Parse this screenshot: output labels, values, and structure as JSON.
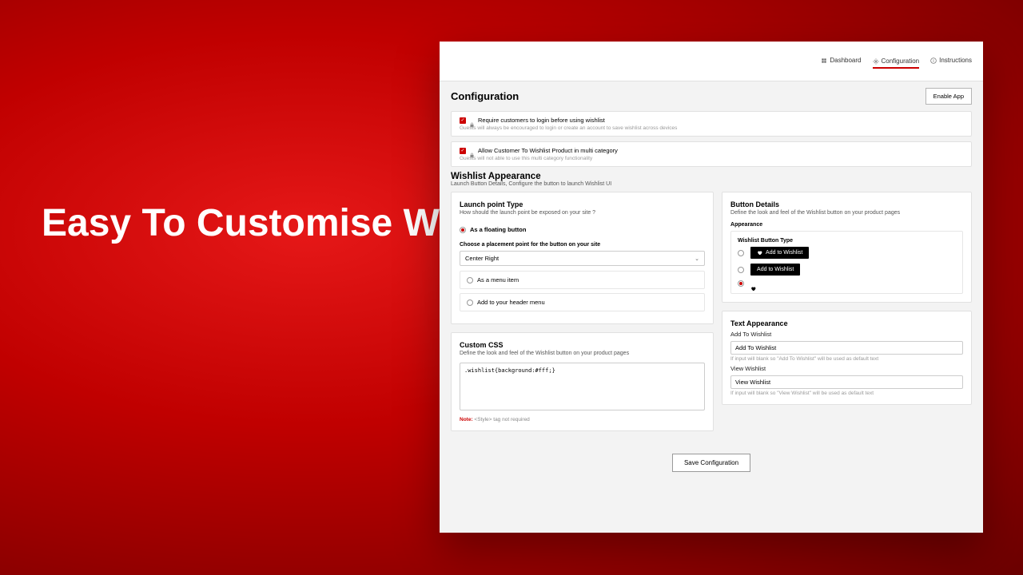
{
  "hero": "Easy To Customise With Custom CSS",
  "nav": {
    "dashboard": "Dashboard",
    "configuration": "Configuration",
    "instructions": "Instructions"
  },
  "page": {
    "title": "Configuration",
    "enable": "Enable App"
  },
  "opt1": {
    "label": "Require customers to login before using wishlist",
    "help": "Guests will always be encouraged to login or create an account to save wishlist across devices"
  },
  "opt2": {
    "label": "Allow Customer To Wishlist Product in multi category",
    "help": "Guests will not able to use this multi category functionality"
  },
  "appearance": {
    "title": "Wishlist Appearance",
    "sub": "Launch Button Details, Configure the button to launch Wishlist UI"
  },
  "launch": {
    "title": "Launch point Type",
    "sub": "How should the launch point be exposed on your site ?",
    "r1": "As a floating button",
    "placementLabel": "Choose a placement point for the button on your site",
    "placementValue": "Center Right",
    "r2": "As a menu item",
    "r3": "Add to your header menu"
  },
  "buttonDetails": {
    "title": "Button Details",
    "sub": "Define the look and feel of the Wishlist button on your product pages",
    "appLabel": "Appearance",
    "typeLabel": "Wishlist Button Type",
    "b1": "Add to Wishlist",
    "b2": "Add to Wishlist"
  },
  "customCss": {
    "title": "Custom CSS",
    "sub": "Define the look and feel of the Wishlist button on your product pages",
    "value": ".wishlist{background:#fff;}",
    "noteRed": "Note:",
    "noteGray": " <Style> tag not required"
  },
  "textApp": {
    "title": "Text Appearance",
    "l1": "Add To Wishlist",
    "v1": "Add To Wishlist",
    "h1": "If input will blank so \"Add To Wishlist\" will be used as default text",
    "l2": "View Wishlist",
    "v2": "View Wishlist",
    "h2": "If input will blank so \"View Wishlist\" will be used as default text"
  },
  "save": "Save Configuration"
}
